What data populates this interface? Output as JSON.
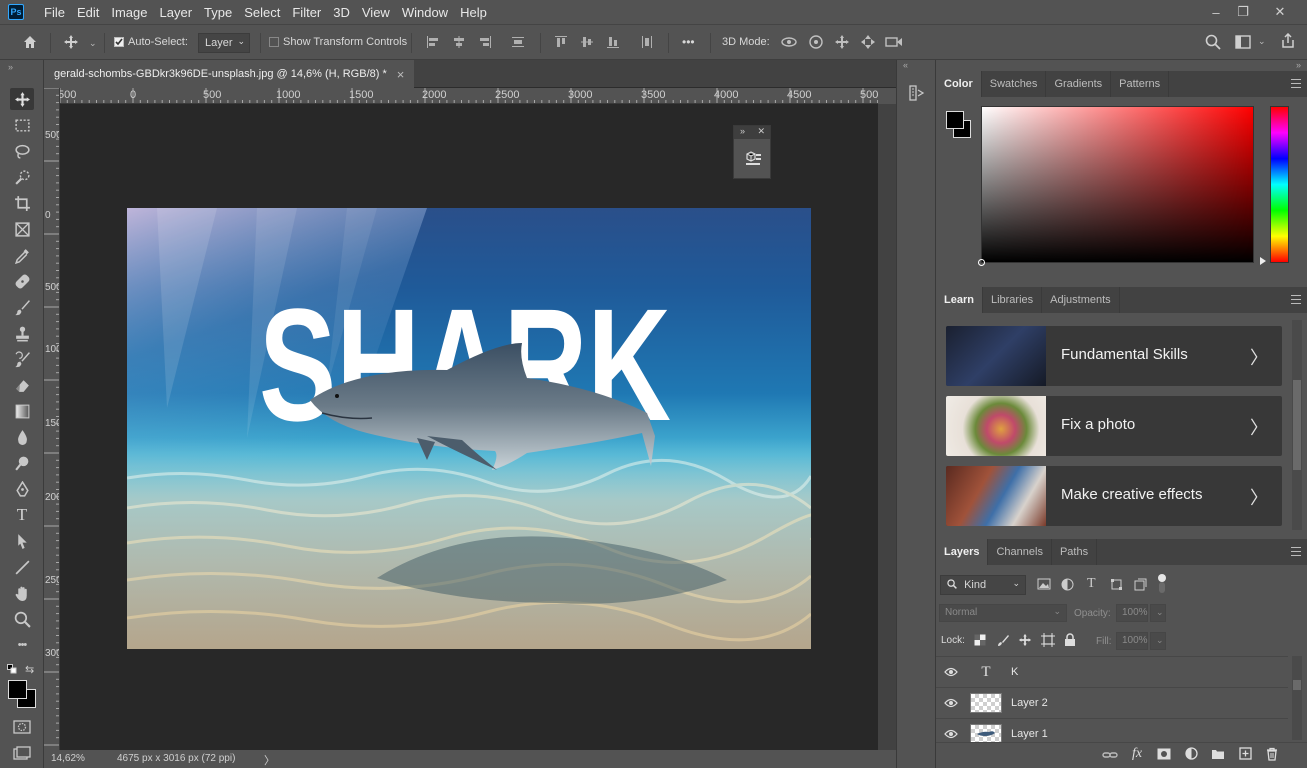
{
  "app": {
    "logo": "Ps"
  },
  "menu": [
    "File",
    "Edit",
    "Image",
    "Layer",
    "Type",
    "Select",
    "Filter",
    "3D",
    "View",
    "Window",
    "Help"
  ],
  "window_controls": {
    "minimize": "–",
    "restore": "❐",
    "close": "✕"
  },
  "options": {
    "auto_select_label": "Auto-Select:",
    "auto_select_checked": true,
    "auto_select_target": "Layer",
    "transform_controls_label": "Show Transform Controls",
    "transform_controls_checked": false,
    "more": "•••",
    "mode3d_label": "3D Mode:"
  },
  "document": {
    "tab_title": "gerald-schombs-GBDkr3k96DE-unsplash.jpg @ 14,6% (H, RGB/8) *",
    "close_glyph": "×",
    "image_text": "SHARK"
  },
  "ruler": {
    "top_labels": [
      "500",
      "0",
      "500",
      "1000",
      "1500",
      "2000",
      "2500",
      "3000",
      "3500",
      "4000",
      "4500",
      "500"
    ],
    "left_labels": [
      "500",
      "0",
      "500",
      "1000",
      "1500",
      "2000",
      "2500",
      "3000"
    ]
  },
  "status": {
    "zoom": "14,62%",
    "doc_info": "4675 px x 3016 px (72 ppi)",
    "arrow": "〉"
  },
  "color_panel": {
    "tabs": [
      "Color",
      "Swatches",
      "Gradients",
      "Patterns"
    ],
    "active_tab": "Color",
    "foreground": "#000000",
    "background": "#000000",
    "picker_hue": "#ff0000"
  },
  "learn_panel": {
    "tabs": [
      "Learn",
      "Libraries",
      "Adjustments"
    ],
    "active_tab": "Learn",
    "cards": [
      {
        "title": "Fundamental Skills",
        "arrow": "〉"
      },
      {
        "title": "Fix a photo",
        "arrow": "〉"
      },
      {
        "title": "Make creative effects",
        "arrow": "〉"
      }
    ]
  },
  "layers_panel": {
    "tabs": [
      "Layers",
      "Channels",
      "Paths"
    ],
    "active_tab": "Layers",
    "filter_kind": "Kind",
    "blend_mode": "Normal",
    "opacity_label": "Opacity:",
    "opacity_value": "100%",
    "lock_label": "Lock:",
    "fill_label": "Fill:",
    "fill_value": "100%",
    "layers": [
      {
        "name": "K",
        "type": "text",
        "visible": true
      },
      {
        "name": "Layer 2",
        "type": "pixel",
        "visible": true
      },
      {
        "name": "Layer 1",
        "type": "pixel",
        "visible": true
      }
    ],
    "footer_icons": [
      "link-icon",
      "fx-icon",
      "mask-icon",
      "adjustment-icon",
      "group-icon",
      "new-layer-icon",
      "trash-icon"
    ],
    "fx_label": "fx"
  },
  "tools": [
    "move-tool-icon",
    "marquee-tool-icon",
    "lasso-tool-icon",
    "quick-select-tool-icon",
    "crop-tool-icon",
    "frame-tool-icon",
    "eyedropper-tool-icon",
    "healing-brush-tool-icon",
    "brush-tool-icon",
    "clone-stamp-tool-icon",
    "history-brush-tool-icon",
    "eraser-tool-icon",
    "gradient-tool-icon",
    "blur-tool-icon",
    "dodge-tool-icon",
    "pen-tool-icon",
    "type-tool-icon",
    "path-select-tool-icon",
    "line-tool-icon",
    "hand-tool-icon",
    "zoom-tool-icon",
    "more-tools-icon"
  ],
  "more_tools_glyph": "•••",
  "type_tool_glyph": "T"
}
